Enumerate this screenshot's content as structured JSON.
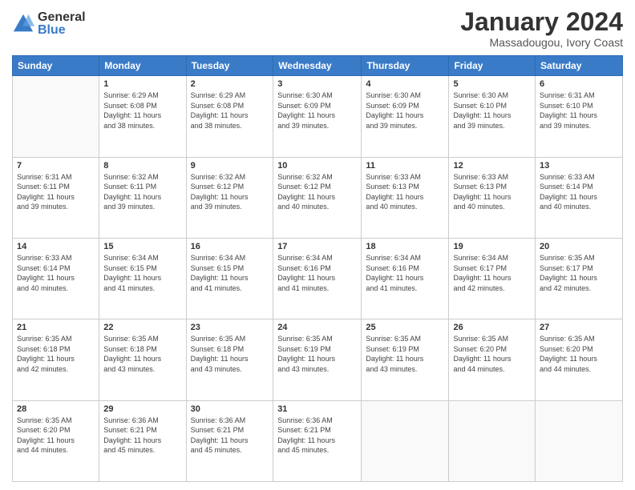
{
  "header": {
    "logo": {
      "general": "General",
      "blue": "Blue"
    },
    "title": "January 2024",
    "location": "Massadougou, Ivory Coast"
  },
  "weekdays": [
    "Sunday",
    "Monday",
    "Tuesday",
    "Wednesday",
    "Thursday",
    "Friday",
    "Saturday"
  ],
  "weeks": [
    [
      {
        "day": "",
        "info": ""
      },
      {
        "day": "1",
        "info": "Sunrise: 6:29 AM\nSunset: 6:08 PM\nDaylight: 11 hours\nand 38 minutes."
      },
      {
        "day": "2",
        "info": "Sunrise: 6:29 AM\nSunset: 6:08 PM\nDaylight: 11 hours\nand 38 minutes."
      },
      {
        "day": "3",
        "info": "Sunrise: 6:30 AM\nSunset: 6:09 PM\nDaylight: 11 hours\nand 39 minutes."
      },
      {
        "day": "4",
        "info": "Sunrise: 6:30 AM\nSunset: 6:09 PM\nDaylight: 11 hours\nand 39 minutes."
      },
      {
        "day": "5",
        "info": "Sunrise: 6:30 AM\nSunset: 6:10 PM\nDaylight: 11 hours\nand 39 minutes."
      },
      {
        "day": "6",
        "info": "Sunrise: 6:31 AM\nSunset: 6:10 PM\nDaylight: 11 hours\nand 39 minutes."
      }
    ],
    [
      {
        "day": "7",
        "info": "Sunrise: 6:31 AM\nSunset: 6:11 PM\nDaylight: 11 hours\nand 39 minutes."
      },
      {
        "day": "8",
        "info": "Sunrise: 6:32 AM\nSunset: 6:11 PM\nDaylight: 11 hours\nand 39 minutes."
      },
      {
        "day": "9",
        "info": "Sunrise: 6:32 AM\nSunset: 6:12 PM\nDaylight: 11 hours\nand 39 minutes."
      },
      {
        "day": "10",
        "info": "Sunrise: 6:32 AM\nSunset: 6:12 PM\nDaylight: 11 hours\nand 40 minutes."
      },
      {
        "day": "11",
        "info": "Sunrise: 6:33 AM\nSunset: 6:13 PM\nDaylight: 11 hours\nand 40 minutes."
      },
      {
        "day": "12",
        "info": "Sunrise: 6:33 AM\nSunset: 6:13 PM\nDaylight: 11 hours\nand 40 minutes."
      },
      {
        "day": "13",
        "info": "Sunrise: 6:33 AM\nSunset: 6:14 PM\nDaylight: 11 hours\nand 40 minutes."
      }
    ],
    [
      {
        "day": "14",
        "info": "Sunrise: 6:33 AM\nSunset: 6:14 PM\nDaylight: 11 hours\nand 40 minutes."
      },
      {
        "day": "15",
        "info": "Sunrise: 6:34 AM\nSunset: 6:15 PM\nDaylight: 11 hours\nand 41 minutes."
      },
      {
        "day": "16",
        "info": "Sunrise: 6:34 AM\nSunset: 6:15 PM\nDaylight: 11 hours\nand 41 minutes."
      },
      {
        "day": "17",
        "info": "Sunrise: 6:34 AM\nSunset: 6:16 PM\nDaylight: 11 hours\nand 41 minutes."
      },
      {
        "day": "18",
        "info": "Sunrise: 6:34 AM\nSunset: 6:16 PM\nDaylight: 11 hours\nand 41 minutes."
      },
      {
        "day": "19",
        "info": "Sunrise: 6:34 AM\nSunset: 6:17 PM\nDaylight: 11 hours\nand 42 minutes."
      },
      {
        "day": "20",
        "info": "Sunrise: 6:35 AM\nSunset: 6:17 PM\nDaylight: 11 hours\nand 42 minutes."
      }
    ],
    [
      {
        "day": "21",
        "info": "Sunrise: 6:35 AM\nSunset: 6:18 PM\nDaylight: 11 hours\nand 42 minutes."
      },
      {
        "day": "22",
        "info": "Sunrise: 6:35 AM\nSunset: 6:18 PM\nDaylight: 11 hours\nand 43 minutes."
      },
      {
        "day": "23",
        "info": "Sunrise: 6:35 AM\nSunset: 6:18 PM\nDaylight: 11 hours\nand 43 minutes."
      },
      {
        "day": "24",
        "info": "Sunrise: 6:35 AM\nSunset: 6:19 PM\nDaylight: 11 hours\nand 43 minutes."
      },
      {
        "day": "25",
        "info": "Sunrise: 6:35 AM\nSunset: 6:19 PM\nDaylight: 11 hours\nand 43 minutes."
      },
      {
        "day": "26",
        "info": "Sunrise: 6:35 AM\nSunset: 6:20 PM\nDaylight: 11 hours\nand 44 minutes."
      },
      {
        "day": "27",
        "info": "Sunrise: 6:35 AM\nSunset: 6:20 PM\nDaylight: 11 hours\nand 44 minutes."
      }
    ],
    [
      {
        "day": "28",
        "info": "Sunrise: 6:35 AM\nSunset: 6:20 PM\nDaylight: 11 hours\nand 44 minutes."
      },
      {
        "day": "29",
        "info": "Sunrise: 6:36 AM\nSunset: 6:21 PM\nDaylight: 11 hours\nand 45 minutes."
      },
      {
        "day": "30",
        "info": "Sunrise: 6:36 AM\nSunset: 6:21 PM\nDaylight: 11 hours\nand 45 minutes."
      },
      {
        "day": "31",
        "info": "Sunrise: 6:36 AM\nSunset: 6:21 PM\nDaylight: 11 hours\nand 45 minutes."
      },
      {
        "day": "",
        "info": ""
      },
      {
        "day": "",
        "info": ""
      },
      {
        "day": "",
        "info": ""
      }
    ]
  ]
}
